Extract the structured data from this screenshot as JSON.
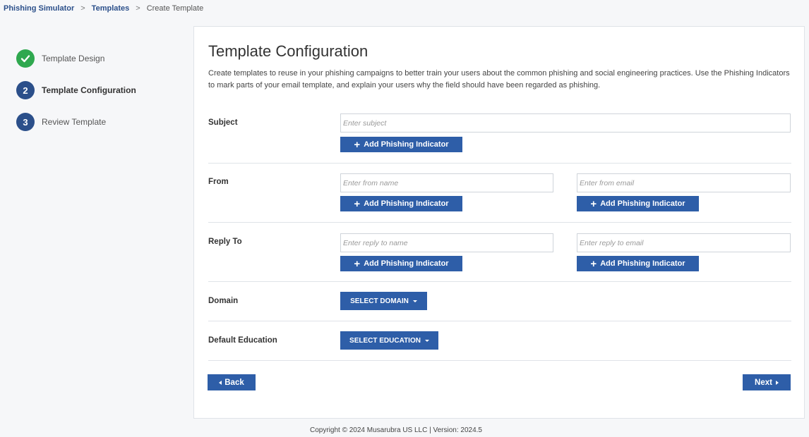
{
  "breadcrumb": {
    "root": "Phishing Simulator",
    "templates": "Templates",
    "current": "Create Template",
    "separator": ">"
  },
  "steps": [
    {
      "label": "Template Design",
      "marker": "✓",
      "state": "done"
    },
    {
      "label": "Template Configuration",
      "marker": "2",
      "state": "active"
    },
    {
      "label": "Review Template",
      "marker": "3",
      "state": "pending"
    }
  ],
  "card": {
    "title": "Template Configuration",
    "description": "Create templates to reuse in your phishing campaigns to better train your users about the common phishing and social engineering practices. Use the Phishing Indicators to mark parts of your email template, and explain your users why the field should have been regarded as phishing."
  },
  "subject": {
    "label": "Subject",
    "placeholder": "Enter subject",
    "button": "Add Phishing Indicator"
  },
  "from": {
    "label": "From",
    "name_placeholder": "Enter from name",
    "email_placeholder": "Enter from email",
    "button": "Add Phishing Indicator"
  },
  "reply_to": {
    "label": "Reply To",
    "name_placeholder": "Enter reply to name",
    "email_placeholder": "Enter reply to email",
    "button": "Add Phishing Indicator"
  },
  "domain": {
    "label": "Domain",
    "button": "SELECT DOMAIN"
  },
  "education": {
    "label": "Default Education",
    "button": "SELECT EDUCATION"
  },
  "nav": {
    "back": "Back",
    "next": "Next"
  },
  "footer": "Copyright © 2024 Musarubra US LLC | Version: 2024.5",
  "colors": {
    "primary": "#2e5ea8",
    "step_done": "#2fa84f",
    "step_number": "#2b4f8a"
  }
}
